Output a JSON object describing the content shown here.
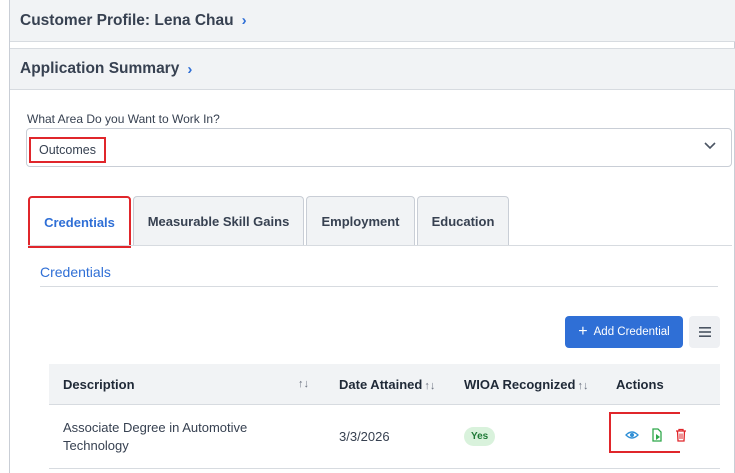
{
  "profile": {
    "title": "Customer Profile: Lena Chau",
    "chevron": "›"
  },
  "summary": {
    "title": "Application Summary",
    "chevron": "›"
  },
  "area": {
    "label": "What Area Do you Want to Work In?",
    "value": "Outcomes"
  },
  "tabs": [
    {
      "label": "Credentials",
      "active": true
    },
    {
      "label": "Measurable Skill Gains",
      "active": false
    },
    {
      "label": "Employment",
      "active": false
    },
    {
      "label": "Education",
      "active": false
    }
  ],
  "section_title": "Credentials",
  "toolbar": {
    "add_label": "Add Credential",
    "add_icon": "plus-icon",
    "menu_icon": "hamburger-menu-icon"
  },
  "table": {
    "columns": [
      "Description",
      "Date Attained",
      "WIOA Recognized",
      "Actions"
    ],
    "sort_glyph": "↑↓",
    "rows": [
      {
        "description": "Associate Degree in Automotive Technology",
        "date": "3/3/2026",
        "wioa": "Yes",
        "actions": [
          "view-eye-icon",
          "edit-document-icon",
          "delete-trash-icon"
        ]
      }
    ]
  },
  "colors": {
    "primary": "#2f6fd6",
    "highlight": "#e0262b",
    "success_bg": "#d9f2dc",
    "success_text": "#1f7a37"
  }
}
